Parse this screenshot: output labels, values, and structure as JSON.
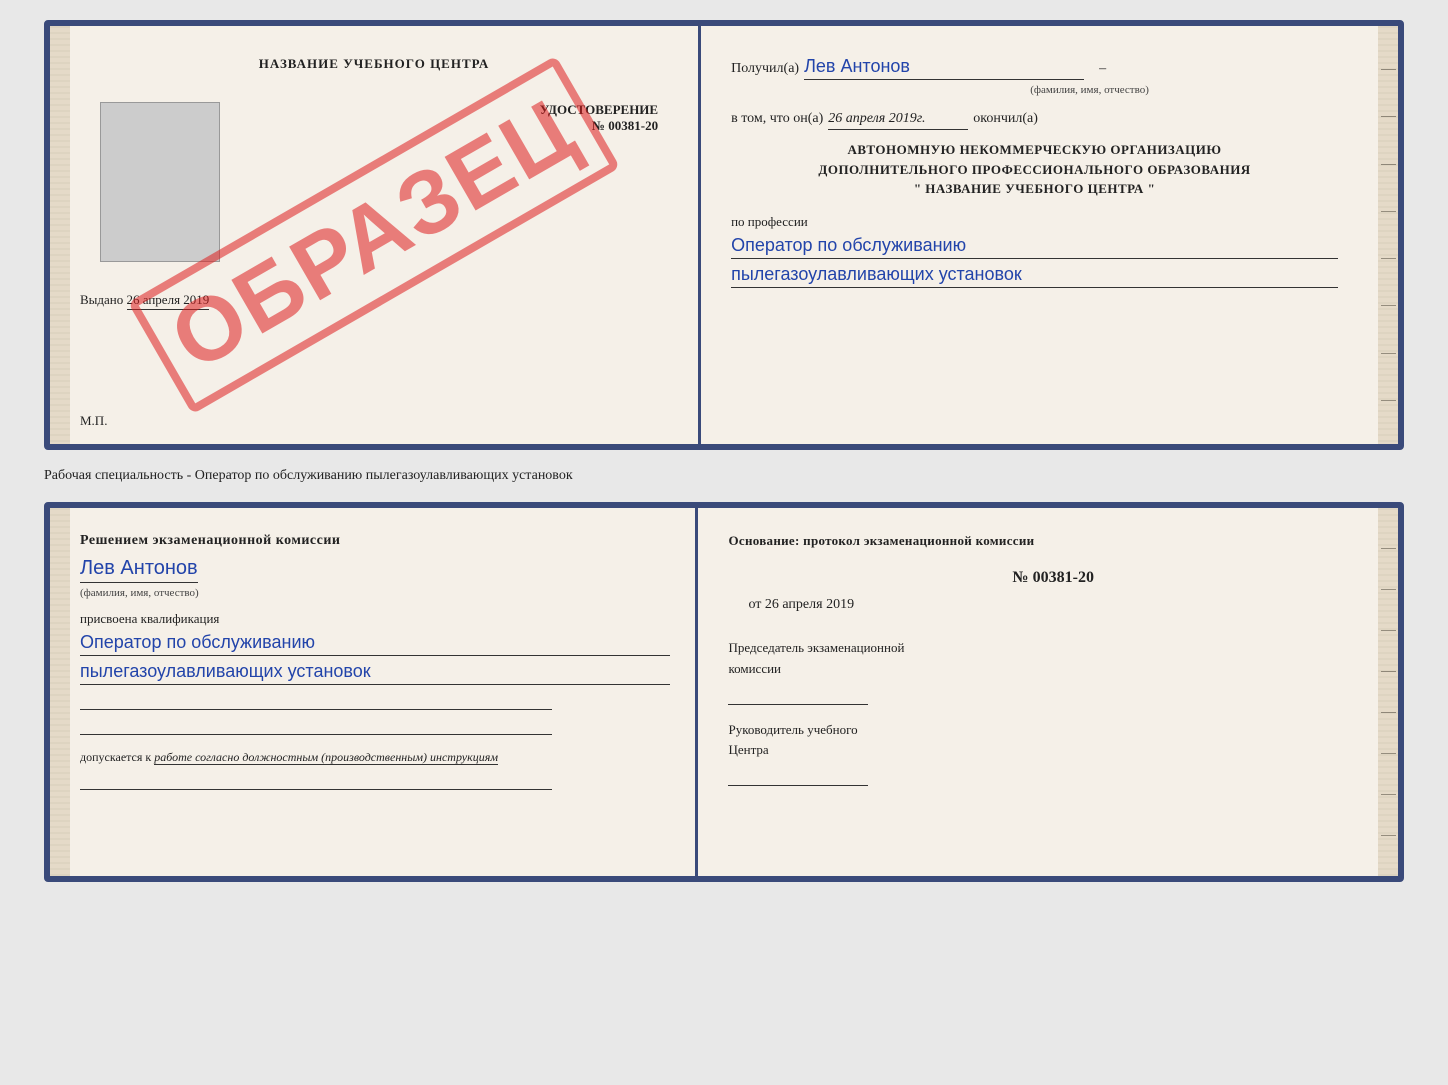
{
  "cert": {
    "left": {
      "title": "НАЗВАНИЕ УЧЕБНОГО ЦЕНТРА",
      "doc_type_label": "УДОСТОВЕРЕНИЕ",
      "doc_number_prefix": "№",
      "doc_number": "00381-20",
      "issued_label": "Выдано",
      "issued_date": "26 апреля 2019",
      "mp_label": "М.П.",
      "stamp_text": "ОБРАЗЕЦ"
    },
    "right": {
      "received_label": "Получил(а)",
      "received_name": "Лев Антонов",
      "name_subtitle": "(фамилия, имя, отчество)",
      "in_that_label": "в том, что он(а)",
      "date_value": "26 апреля 2019г.",
      "finished_label": "окончил(а)",
      "org_line1": "АВТОНОМНУЮ НЕКОММЕРЧЕСКУЮ ОРГАНИЗАЦИЮ",
      "org_line2": "ДОПОЛНИТЕЛЬНОГО ПРОФЕССИОНАЛЬНОГО ОБРАЗОВАНИЯ",
      "org_name": "\"  НАЗВАНИЕ УЧЕБНОГО ЦЕНТРА  \"",
      "profession_label": "по профессии",
      "profession_line1": "Оператор по обслуживанию",
      "profession_line2": "пылегазоулавливающих установок"
    }
  },
  "between": {
    "text": "Рабочая специальность - Оператор по обслуживанию пылегазоулавливающих установок"
  },
  "diploma": {
    "left": {
      "decision_label": "Решением экзаменационной комиссии",
      "person_name": "Лев Антонов",
      "name_subtitle": "(фамилия, имя, отчество)",
      "qualification_label": "присвоена квалификация",
      "qualification_line1": "Оператор по обслуживанию",
      "qualification_line2": "пылегазоулавливающих установок",
      "allowed_label": "допускается к",
      "allowed_value": "работе согласно должностным (производственным) инструкциям"
    },
    "right": {
      "basis_label": "Основание: протокол экзаменационной комиссии",
      "number_prefix": "№",
      "number_value": "00381-20",
      "date_prefix": "от",
      "date_value": "26 апреля 2019",
      "chairman_label": "Председатель экзаменационной",
      "chairman_label2": "комиссии",
      "head_label": "Руководитель учебного",
      "head_label2": "Центра"
    }
  }
}
